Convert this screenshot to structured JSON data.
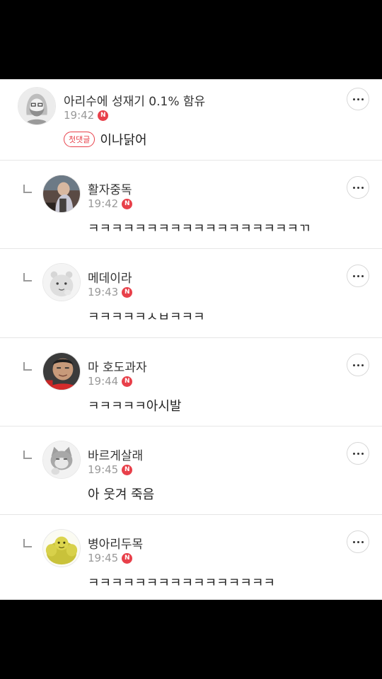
{
  "comments": [
    {
      "nickname": "아리수에 성재기 0.1% 함유",
      "time": "19:42",
      "new_badge": "N",
      "first_badge": "첫댓글",
      "text": "이나닭어",
      "avatar_icon": "bearded-man-drawing-avatar",
      "reply": false
    },
    {
      "nickname": "활자중독",
      "time": "19:42",
      "new_badge": "N",
      "text": "ㅋㅋㅋㅋㅋㅋㅋㅋㅋㅋㅋㅋㅋㅋㅋㅋㅋㅋㄲ",
      "avatar_icon": "person-photo-avatar",
      "reply": true
    },
    {
      "nickname": "메데이라",
      "time": "19:43",
      "new_badge": "N",
      "text": "ㅋㅋㅋㅋㅋㅅㅂㅋㅋㅋ",
      "avatar_icon": "default-character-avatar",
      "reply": true
    },
    {
      "nickname": "마 호도과자",
      "time": "19:44",
      "new_badge": "N",
      "text": "ㅋㅋㅋㅋㅋ아시발",
      "avatar_icon": "man-face-photo-avatar",
      "reply": true
    },
    {
      "nickname": "바르게살래",
      "time": "19:45",
      "new_badge": "N",
      "text": "아 웃겨 죽음",
      "avatar_icon": "cat-character-avatar",
      "reply": true
    },
    {
      "nickname": "병아리두목",
      "time": "19:45",
      "new_badge": "N",
      "text": "ㅋㅋㅋㅋㅋㅋㅋㅋㅋㅋㅋㅋㅋㅋㅋㅋ",
      "avatar_icon": "muscle-man-avatar",
      "reply": true
    }
  ],
  "colors": {
    "new_badge": "#e8404a",
    "first_badge": "#e8404a",
    "time": "#999999",
    "divider": "#e6e6e6"
  }
}
